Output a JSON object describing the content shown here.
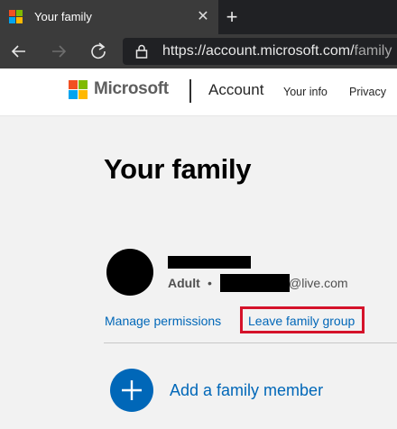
{
  "browser": {
    "tab_title": "Your family",
    "url_main": "https://account.microsoft.com/",
    "url_rest": "family"
  },
  "header": {
    "brand": "Microsoft",
    "section": "Account",
    "nav": [
      "Your info",
      "Privacy"
    ]
  },
  "main": {
    "title": "Your family",
    "member": {
      "role": "Adult",
      "separator": "•",
      "email_suffix": "@live.com"
    },
    "actions": {
      "manage": "Manage permissions",
      "leave": "Leave family group"
    },
    "add_member": "Add a family member"
  },
  "colors": {
    "link": "#0067b8",
    "highlight": "#d5122a"
  }
}
